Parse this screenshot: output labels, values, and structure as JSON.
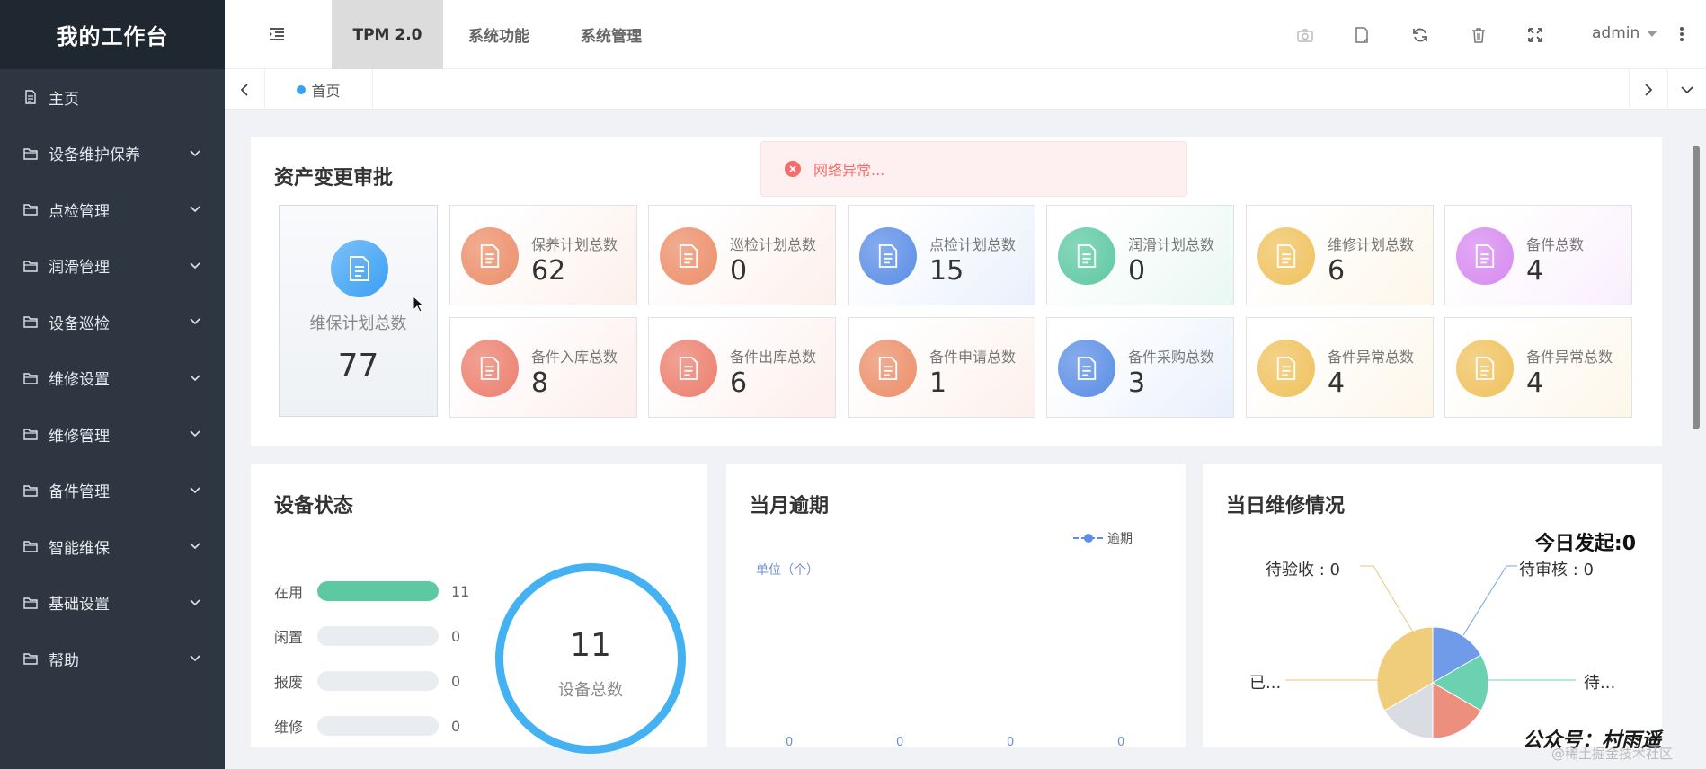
{
  "sidebar": {
    "title": "我的工作台",
    "items": [
      {
        "label": "主页",
        "has_children": false
      },
      {
        "label": "设备维护保养",
        "has_children": true
      },
      {
        "label": "点检管理",
        "has_children": true
      },
      {
        "label": "润滑管理",
        "has_children": true
      },
      {
        "label": "设备巡检",
        "has_children": true
      },
      {
        "label": "维修设置",
        "has_children": true
      },
      {
        "label": "维修管理",
        "has_children": true
      },
      {
        "label": "备件管理",
        "has_children": true
      },
      {
        "label": "智能维保",
        "has_children": true
      },
      {
        "label": "基础设置",
        "has_children": true
      },
      {
        "label": "帮助",
        "has_children": true
      }
    ]
  },
  "topbar": {
    "tabs": [
      {
        "label": "TPM 2.0",
        "active": true
      },
      {
        "label": "系统功能",
        "active": false
      },
      {
        "label": "系统管理",
        "active": false
      }
    ],
    "tools": [
      "camera-icon",
      "note-icon",
      "refresh-icon",
      "trash-icon",
      "fullscreen-icon"
    ],
    "user": "admin"
  },
  "tabsbar": {
    "home_tab": "首页"
  },
  "alert": {
    "text": "网络异常..."
  },
  "approval": {
    "title": "资产变更审批",
    "main_stat": {
      "label": "维保计划总数",
      "value": "77",
      "color": "#3a9ff5"
    },
    "stats": [
      {
        "label": "保养计划总数",
        "value": "62",
        "color": "#ec8f6a"
      },
      {
        "label": "巡检计划总数",
        "value": "0",
        "color": "#ec8f6a"
      },
      {
        "label": "点检计划总数",
        "value": "15",
        "color": "#5b8ee6"
      },
      {
        "label": "润滑计划总数",
        "value": "0",
        "color": "#5dc9a3"
      },
      {
        "label": "维修计划总数",
        "value": "6",
        "color": "#f0c25e"
      },
      {
        "label": "备件总数",
        "value": "4",
        "color": "#d78af0"
      },
      {
        "label": "备件入库总数",
        "value": "8",
        "color": "#ec7f6e"
      },
      {
        "label": "备件出库总数",
        "value": "6",
        "color": "#ec7f6e"
      },
      {
        "label": "备件申请总数",
        "value": "1",
        "color": "#ec8f6a"
      },
      {
        "label": "备件采购总数",
        "value": "3",
        "color": "#5b8ee6"
      },
      {
        "label": "备件异常总数",
        "value": "4",
        "color": "#f0c25e"
      },
      {
        "label": "备件异常总数",
        "value": "4",
        "color": "#f0c25e"
      }
    ]
  },
  "device_status": {
    "title": "设备状态",
    "rows": [
      {
        "label": "在用",
        "value": "11",
        "fraction": 1.0,
        "color": "#5dc9a3"
      },
      {
        "label": "闲置",
        "value": "0",
        "fraction": 0,
        "color": "#5dc9a3"
      },
      {
        "label": "报废",
        "value": "0",
        "fraction": 0,
        "color": "#5dc9a3"
      },
      {
        "label": "维修",
        "value": "0",
        "fraction": 0,
        "color": "#5dc9a3"
      }
    ],
    "total_value": "11",
    "total_label": "设备总数"
  },
  "overdue": {
    "title": "当月逾期",
    "legend": "逾期",
    "unit": "单位（个）",
    "axis_values": [
      "0",
      "0",
      "0",
      "0"
    ]
  },
  "repair": {
    "title": "当日维修情况",
    "today_started": "今日发起:0",
    "labels": {
      "pending_accept": "待验收 : 0",
      "pending_review": "待审核 : 0",
      "done": "已...",
      "pending_other": "待..."
    },
    "slices": [
      {
        "color": "#6f9be8",
        "value": 1
      },
      {
        "color": "#6cd1b0",
        "value": 1
      },
      {
        "color": "#ec8f7e",
        "value": 1
      },
      {
        "color": "#d9dde3",
        "value": 1
      },
      {
        "color": "#f0cd7a",
        "value": 2
      }
    ]
  },
  "watermark": {
    "main": "公众号：村雨遥",
    "sub": "@稀土掘金技术社区"
  }
}
